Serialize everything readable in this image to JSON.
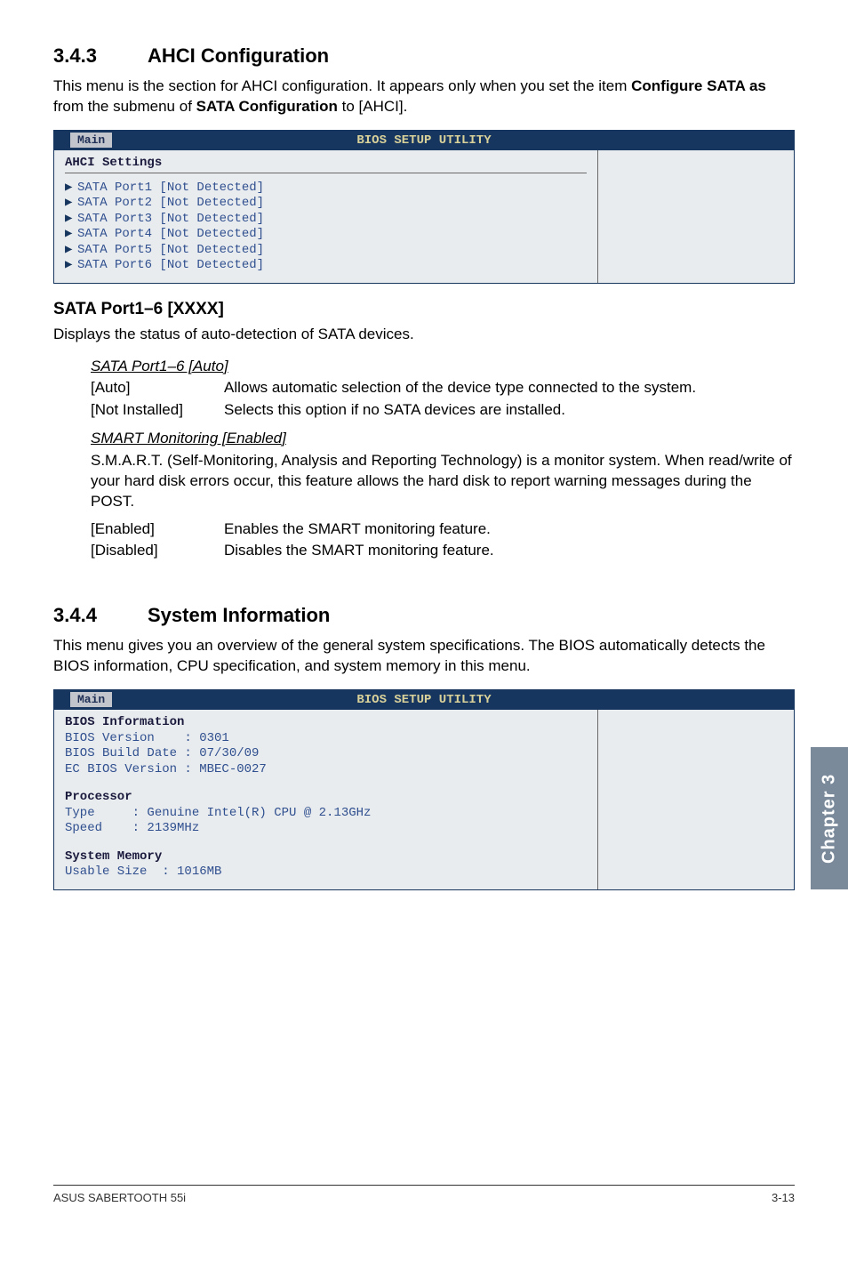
{
  "side_tab": "Chapter 3",
  "sec343": {
    "num": "3.4.3",
    "title": "AHCI Configuration",
    "intro_pre": "This menu is the section for AHCI configuration. It appears only when you set the item ",
    "intro_bold1": "Configure SATA as",
    "intro_mid": " from the submenu of ",
    "intro_bold2": "SATA Configuration",
    "intro_post": " to [AHCI]."
  },
  "bios1": {
    "header": "BIOS SETUP UTILITY",
    "tab": "Main",
    "title": "AHCI Settings",
    "rows": [
      "SATA Port1 [Not Detected]",
      "SATA Port2 [Not Detected]",
      "SATA Port3 [Not Detected]",
      "SATA Port4 [Not Detected]",
      "SATA Port5 [Not Detected]",
      "SATA Port6 [Not Detected]"
    ]
  },
  "sata_section": {
    "heading": "SATA Port1–6 [XXXX]",
    "desc": "Displays the status of auto-detection of SATA devices.",
    "sata_ui": "SATA Port1–6 [Auto]",
    "auto_key": "[Auto]",
    "auto_val": "Allows automatic selection of the device type connected to the system.",
    "not_key": "[Not Installed]",
    "not_val": "Selects this option if no SATA devices are installed.",
    "smart_ui": "SMART Monitoring [Enabled]",
    "smart_desc": "S.M.A.R.T. (Self-Monitoring, Analysis and Reporting Technology) is a monitor system. When read/write of your hard disk errors occur, this feature allows the hard disk to report warning messages during the POST.",
    "en_key": "[Enabled]",
    "en_val": "Enables the SMART monitoring feature.",
    "dis_key": "[Disabled]",
    "dis_val": "Disables the SMART monitoring feature."
  },
  "sec344": {
    "num": "3.4.4",
    "title": "System Information",
    "intro": "This menu gives you an overview of the general system specifications. The BIOS automatically detects the BIOS information, CPU specification, and system memory in this menu."
  },
  "bios2": {
    "header": "BIOS SETUP UTILITY",
    "tab": "Main",
    "h_bios": "BIOS Information",
    "l_biosver": "BIOS Version    : 0301",
    "l_biosdate": "BIOS Build Date : 07/30/09",
    "l_ecbios": "EC BIOS Version : MBEC-0027",
    "h_proc": "Processor",
    "l_type": "Type     : Genuine Intel(R) CPU @ 2.13GHz",
    "l_speed": "Speed    : 2139MHz",
    "h_mem": "System Memory",
    "l_usable": "Usable Size  : 1016MB"
  },
  "footer": {
    "left": "ASUS SABERTOOTH 55i",
    "right": "3-13"
  }
}
